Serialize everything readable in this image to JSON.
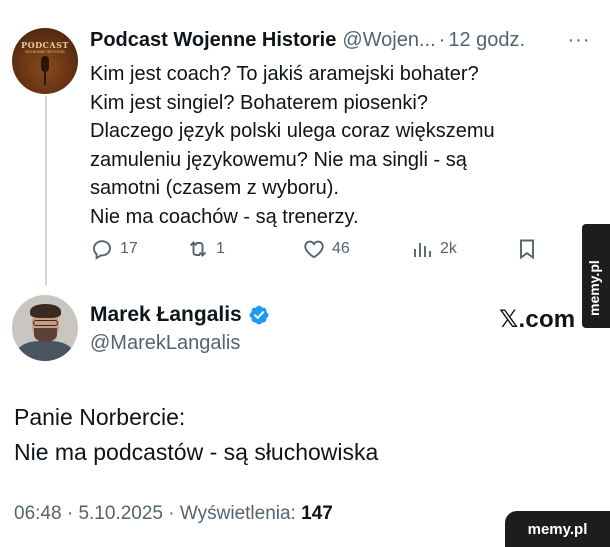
{
  "reply_to": {
    "avatar_text": "PODCAST",
    "avatar_subtext": "WOJENNE HISTORIE",
    "name": "Podcast Wojenne Historie",
    "handle": "@Wojen...",
    "separator": "·",
    "time": "12 godz.",
    "more_label": "···",
    "lines": [
      "Kim jest coach? To jakiś aramejski bohater?",
      "Kim jest singiel? Bohaterem piosenki?",
      "Dlaczego język polski ulega coraz większemu",
      "zamuleniu językowemu? Nie ma singli - są",
      "samotni (czasem z wyboru).",
      "Nie ma coachów - są trenerzy."
    ],
    "actions": {
      "replies": "17",
      "reposts": "1",
      "likes": "46",
      "views": "2k"
    },
    "icons": [
      "reply-icon",
      "repost-icon",
      "like-icon",
      "views-icon",
      "bookmark-icon",
      "share-icon"
    ]
  },
  "post": {
    "name": "Marek Łangalis",
    "handle": "@MarekLangalis",
    "verified_color": "#1d9bf0",
    "lines": [
      "Panie Norbercie:",
      "Nie ma podcastów - są słuchowiska"
    ],
    "time": "06:48",
    "separator1": "·",
    "date": "5.10.2025",
    "separator2": "·",
    "views_label": "Wyświetlenia:",
    "views": "147"
  },
  "brand": "𝕏.com",
  "watermark_side": "memy.pl",
  "watermark_corner": "memy.pl",
  "colors": {
    "text": "#0f1419",
    "secondary": "#536471",
    "thread_line": "#cfd9de",
    "verified": "#1d9bf0"
  }
}
